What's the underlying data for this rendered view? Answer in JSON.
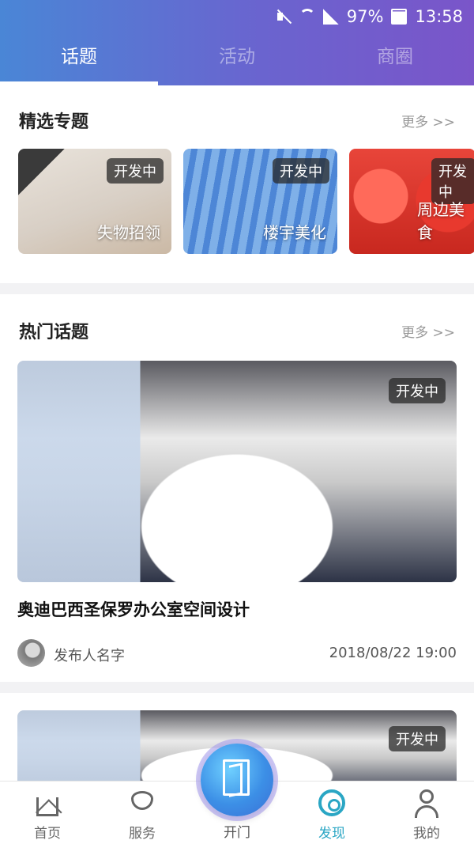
{
  "status_bar": {
    "battery": "97%",
    "time": "13:58"
  },
  "tabs": [
    {
      "label": "话题",
      "active": true
    },
    {
      "label": "活动",
      "active": false
    },
    {
      "label": "商圈",
      "active": false
    }
  ],
  "featured": {
    "title": "精选专题",
    "more": "更多 >>",
    "cards": [
      {
        "label": "失物招领",
        "badge": "开发中"
      },
      {
        "label": "楼宇美化",
        "badge": "开发中"
      },
      {
        "label": "周边美食",
        "badge": "开发中"
      }
    ]
  },
  "hot": {
    "title": "热门话题",
    "more": "更多 >>",
    "items": [
      {
        "badge": "开发中",
        "title": "奥迪巴西圣保罗办公室空间设计",
        "author": "发布人名字",
        "datetime": "2018/08/22   19:00"
      },
      {
        "badge": "开发中"
      }
    ]
  },
  "bottom_nav": [
    {
      "label": "首页",
      "icon": "home-icon",
      "active": false
    },
    {
      "label": "服务",
      "icon": "heart-hand-icon",
      "active": false
    },
    {
      "label": "开门",
      "icon": "door-icon",
      "active": false
    },
    {
      "label": "发现",
      "icon": "discover-icon",
      "active": true
    },
    {
      "label": "我的",
      "icon": "person-icon",
      "active": false
    }
  ],
  "colors": {
    "header_start": "#4a86d6",
    "header_end": "#7a55c9",
    "accent": "#2aa6c4"
  }
}
